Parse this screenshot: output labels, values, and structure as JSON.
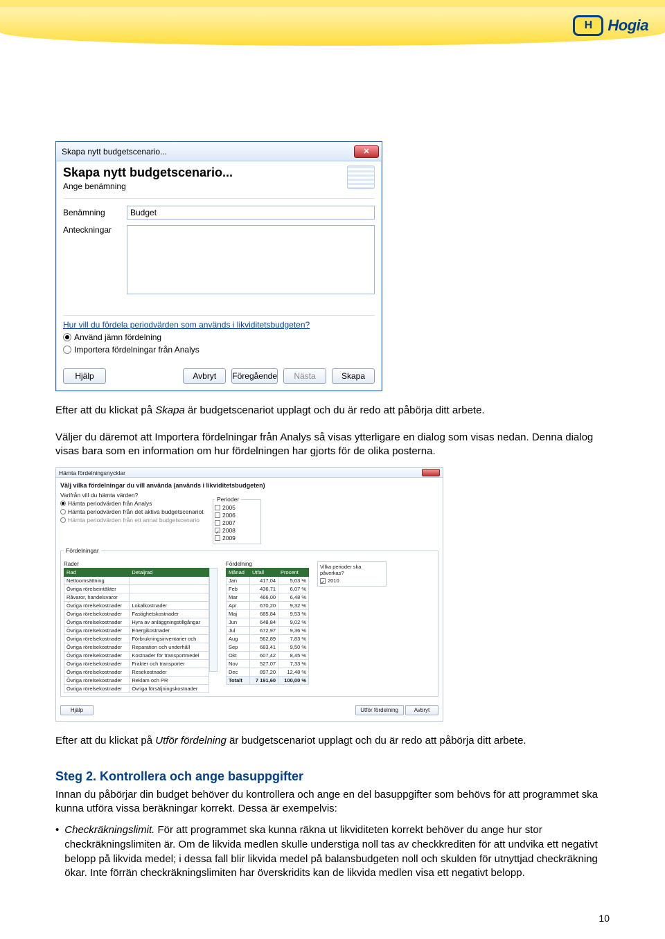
{
  "logo": {
    "mark": "H",
    "text": "Hogia"
  },
  "page_number": "10",
  "dialog1": {
    "window_title": "Skapa nytt budgetscenario...",
    "heading": "Skapa nytt budgetscenario...",
    "subheading": "Ange benämning",
    "label_benamning": "Benämning",
    "value_benamning": "Budget",
    "label_anteckningar": "Anteckningar",
    "link_question": "Hur vill du fördela periodvärden som används i likviditetsbudgeten?",
    "radio_even": "Använd jämn fördelning",
    "radio_import": "Importera fördelningar från Analys",
    "btn_help": "Hjälp",
    "btn_cancel": "Avbryt",
    "btn_prev": "Föregående",
    "btn_next": "Nästa",
    "btn_create": "Skapa"
  },
  "para1_a": "Efter att du klickat på ",
  "para1_b": "Skapa",
  "para1_c": " är budgetscenariot upplagt och du är redo att påbörja ditt arbete.",
  "para2": "Väljer du däremot att Importera fördelningar från Analys så visas ytterligare en dialog som visas nedan. Denna dialog visas bara som en information om hur fördelningen har gjorts för de olika posterna.",
  "dialog2": {
    "window_title": "Hämta fördelningsnycklar",
    "bold_instr": "Välj vilka fördelningar du vill använda (används i likviditetsbudgeten)",
    "q1": "Varifrån vill du hämta värden?",
    "r1": "Hämta periodvärden från Analys",
    "r2": "Hämta periodvärden från det aktiva budgetscenariot",
    "r3": "Hämta periodvärden från ett annat budgetscenario",
    "periods_label": "Perioder",
    "years": [
      "2005",
      "2006",
      "2007",
      "2008",
      "2009"
    ],
    "year_checked": "2008",
    "fordelningar_label": "Fördelningar",
    "rader_label": "Rader",
    "fordelning_label": "Fördelning",
    "right_q": "Vilka perioder ska påverkas?",
    "right_year": "2010",
    "rader_cols": [
      "Rad",
      "Detaljrad"
    ],
    "rader_rows": [
      [
        "Nettoomsättning",
        ""
      ],
      [
        "Övriga rörelseintäkter",
        ""
      ],
      [
        "Råvaror, handelsvaror",
        ""
      ],
      [
        "Övriga rörelsekostnader",
        "Lokalkostnader"
      ],
      [
        "Övriga rörelsekostnader",
        "Fastighetskostnader"
      ],
      [
        "Övriga rörelsekostnader",
        "Hyra av anläggningstillgångar"
      ],
      [
        "Övriga rörelsekostnader",
        "Energikostnader"
      ],
      [
        "Övriga rörelsekostnader",
        "Förbrukningsinventarier och"
      ],
      [
        "Övriga rörelsekostnader",
        "Reparation och underhåll"
      ],
      [
        "Övriga rörelsekostnader",
        "Kostnader för transportmedel"
      ],
      [
        "Övriga rörelsekostnader",
        "Frakter och transporter"
      ],
      [
        "Övriga rörelsekostnader",
        "Resekostnader"
      ],
      [
        "Övriga rörelsekostnader",
        "Reklam och PR"
      ],
      [
        "Övriga rörelsekostnader",
        "Övriga försäljningskostnader"
      ]
    ],
    "ford_cols": [
      "Månad",
      "Utfall",
      "Procent"
    ],
    "ford_rows": [
      [
        "Jan",
        "417,04",
        "5,03 %"
      ],
      [
        "Feb",
        "436,71",
        "6,07 %"
      ],
      [
        "Mar",
        "466,00",
        "6,48 %"
      ],
      [
        "Apr",
        "670,20",
        "9,32 %"
      ],
      [
        "Maj",
        "685,84",
        "9,53 %"
      ],
      [
        "Jun",
        "648,84",
        "9,02 %"
      ],
      [
        "Jul",
        "672,97",
        "9,36 %"
      ],
      [
        "Aug",
        "562,89",
        "7,83 %"
      ],
      [
        "Sep",
        "683,41",
        "9,50 %"
      ],
      [
        "Okt",
        "607,42",
        "8,45 %"
      ],
      [
        "Nov",
        "527,07",
        "7,33 %"
      ],
      [
        "Dec",
        "897,20",
        "12,48 %"
      ]
    ],
    "ford_total": [
      "Totalt",
      "7 191,60",
      "100,00 %"
    ],
    "btn_help": "Hjälp",
    "btn_utfor": "Utför fördelning",
    "btn_avbryt": "Avbryt"
  },
  "para3_a": "Efter att du klickat på ",
  "para3_b": "Utför fördelning",
  "para3_c": " är budgetscenariot upplagt och du är redo att påbörja ditt arbete.",
  "step2_heading": "Steg 2. Kontrollera och ange basuppgifter",
  "step2_para": "Innan du påbörjar din budget behöver du kontrollera och ange en del basuppgifter som behövs för att programmet ska kunna utföra vissa beräkningar korrekt. Dessa är exempelvis:",
  "bullet_term": "Checkräkningslimit.",
  "bullet_text": " För att programmet ska kunna räkna ut likviditeten korrekt behöver du ange hur stor checkräkningslimiten är. Om de likvida medlen skulle understiga noll tas av checkkrediten för att undvika ett negativt belopp på likvida medel; i dessa fall blir likvida medel på balansbudgeten noll och skulden för utnyttjad checkräkning ökar. Inte förrän checkräkningslimiten har överskridits kan de likvida medlen visa ett negativt belopp."
}
